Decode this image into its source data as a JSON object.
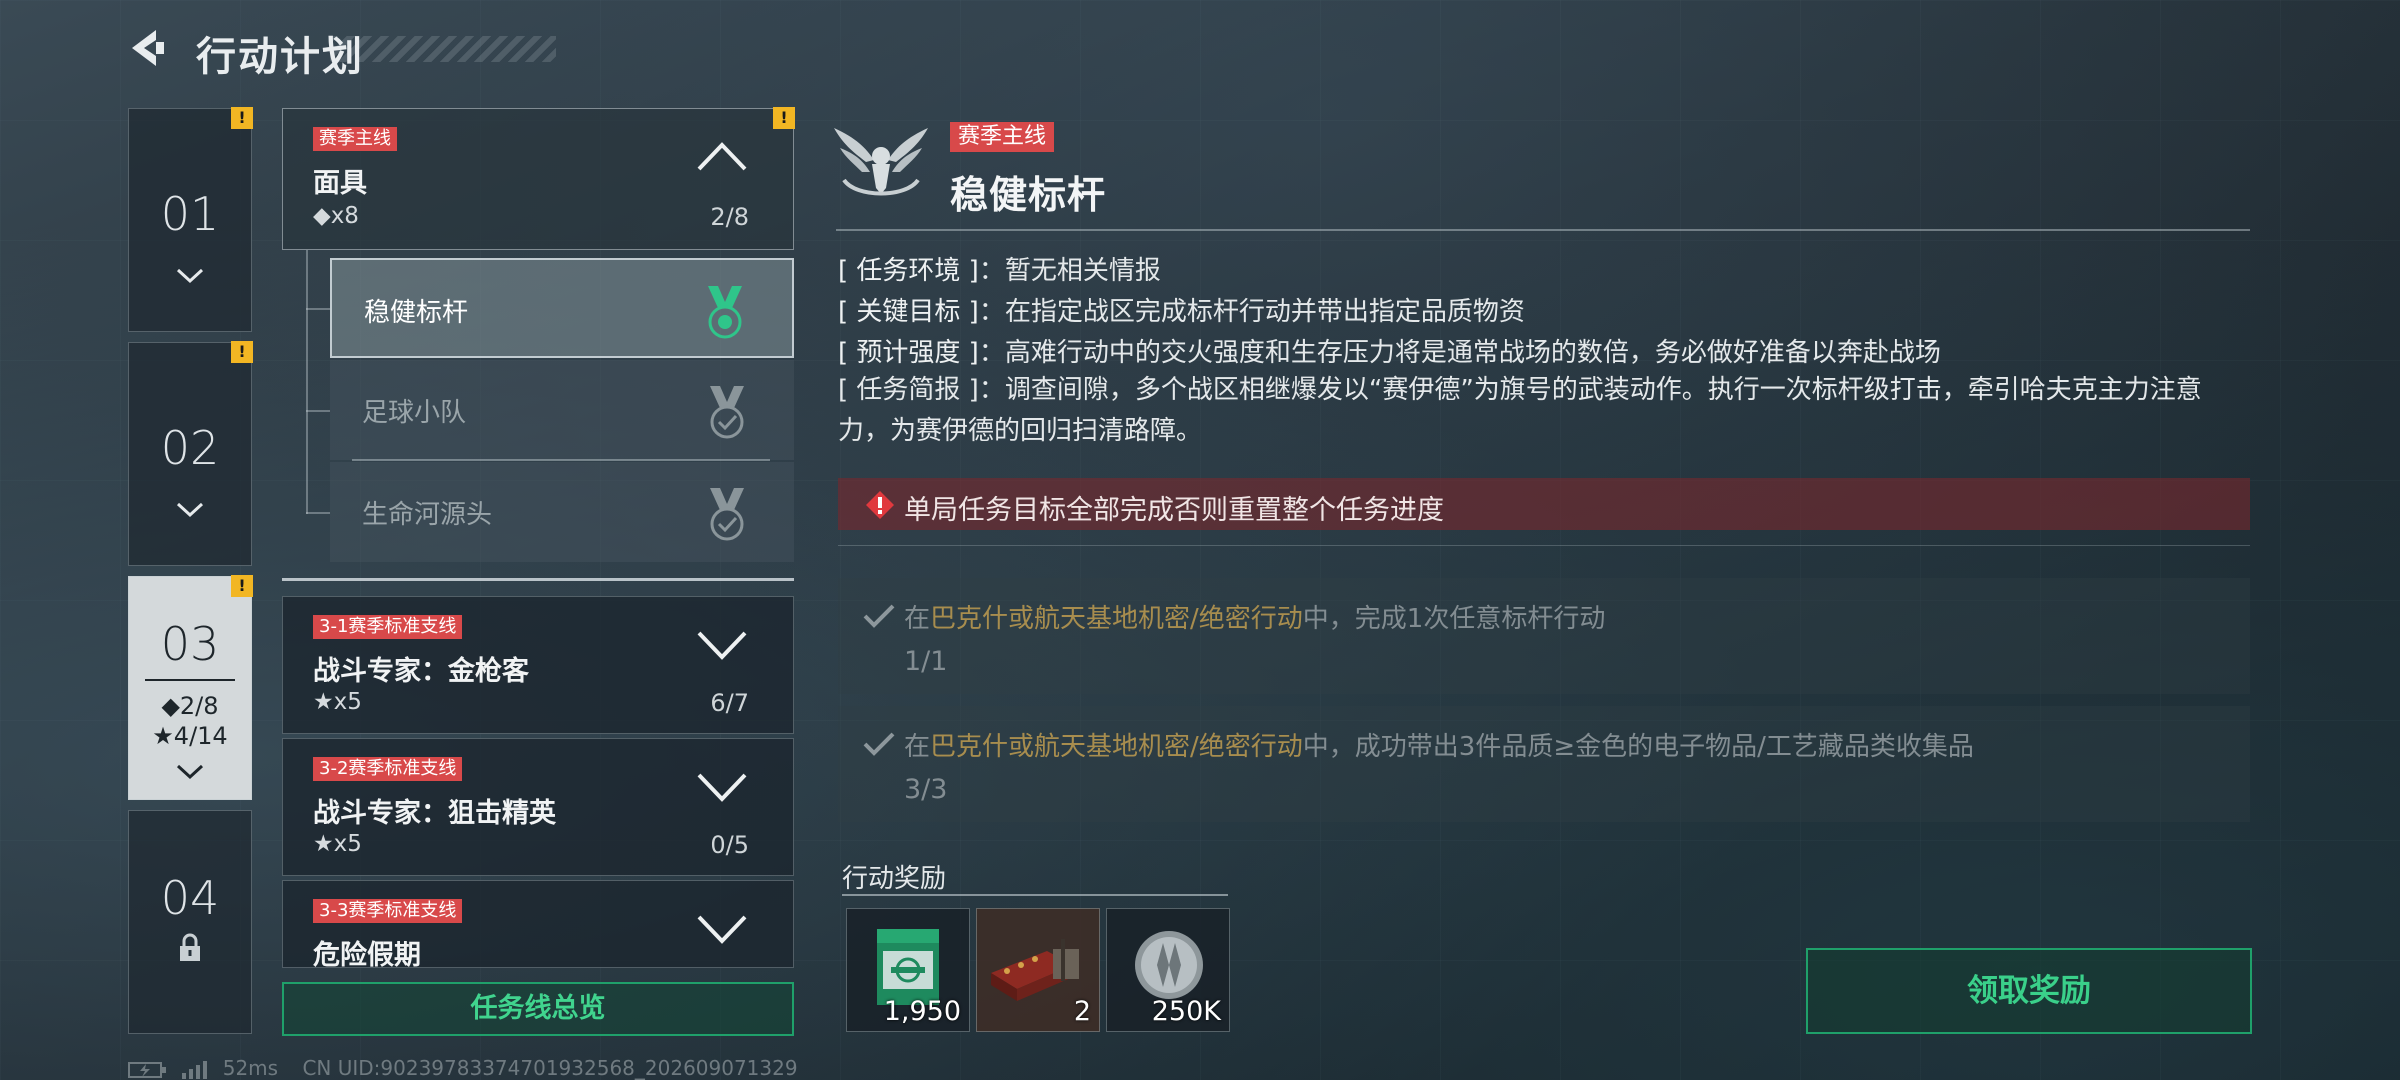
{
  "header": {
    "title": "行动计划"
  },
  "chapters": [
    {
      "num": "01",
      "alert": "!"
    },
    {
      "num": "02",
      "alert": "!"
    },
    {
      "num": "03",
      "alert": "!",
      "stat_masks": "◆2/8",
      "stat_stars": "★4/14"
    },
    {
      "num": "04"
    }
  ],
  "missions": {
    "main": {
      "tag": "赛季主线",
      "name": "面具",
      "reward": "◆x8",
      "progress": "2/8",
      "alert": "!"
    },
    "sub_items": [
      {
        "label": "稳健标杆"
      },
      {
        "label": "足球小队"
      },
      {
        "label": "生命河源头"
      }
    ],
    "branches": [
      {
        "tag": "3-1赛季标准支线",
        "name": "战斗专家：金枪客",
        "reward": "★x5",
        "progress": "6/7"
      },
      {
        "tag": "3-2赛季标准支线",
        "name": "战斗专家：狙击精英",
        "reward": "★x5",
        "progress": "0/5"
      },
      {
        "tag": "3-3赛季标准支线",
        "name": "危险假期"
      }
    ],
    "overview_button": "任务线总览"
  },
  "detail": {
    "tag": "赛季主线",
    "title": "稳健标杆",
    "info": [
      {
        "key": "[ 任务环境 ]",
        "sep": "：",
        "value": "暂无相关情报"
      },
      {
        "key": "[ 关键目标 ]",
        "sep": "：",
        "value": "在指定战区完成标杆行动并带出指定品质物资"
      },
      {
        "key": "[ 预计强度 ]",
        "sep": "：",
        "value": "高难行动中的交火强度和生存压力将是通常战场的数倍，务必做好准备以奔赴战场"
      }
    ],
    "brief": {
      "key": "[ 任务简报 ]",
      "sep": "：",
      "value": "调查间隙，多个战区相继爆发以“赛伊德”为旗号的武装动作。执行一次标杆级打击，牵引哈夫克主力注意力，为赛伊德的回归扫清路障。"
    },
    "warning": "单局任务目标全部完成否则重置整个任务进度",
    "objectives": [
      {
        "pre": "在",
        "highlight": "巴克什或航天基地机密/绝密行动",
        "post": "中，完成1次任意标杆行动",
        "progress": "1/1"
      },
      {
        "pre": "在",
        "highlight": "巴克什或航天基地机密/绝密行动",
        "post": "中，成功带出3件品质≥金色的电子物品/工艺藏品类收集品",
        "progress": "3/3"
      }
    ],
    "rewards_title": "行动奖励",
    "rewards": [
      {
        "count": "1,950",
        "icon": "green-box-icon"
      },
      {
        "count": "2",
        "icon": "weapon-crate-icon"
      },
      {
        "count": "250K",
        "icon": "silver-coin-icon"
      }
    ],
    "claim_button": "领取奖励"
  },
  "status": {
    "ping": "52ms",
    "uid": "CN UID:9023978337470193256​8_202609071329"
  },
  "colors": {
    "accent_green": "#1fa06a",
    "tag_red": "#d8494a",
    "alert_yellow": "#f2b623",
    "highlight_gold": "#a88d4e"
  }
}
